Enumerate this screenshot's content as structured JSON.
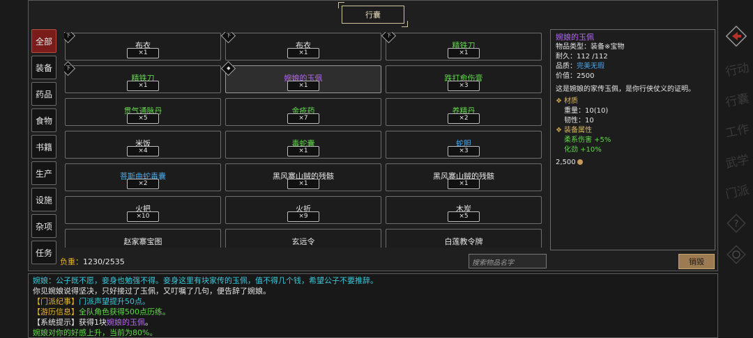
{
  "window": {
    "title": "行囊"
  },
  "categories": [
    "全部",
    "装备",
    "药品",
    "食物",
    "书籍",
    "生产",
    "设施",
    "杂项",
    "任务"
  ],
  "items": [
    {
      "name": "布衣",
      "qty": "×1",
      "color": "white",
      "tag": "下"
    },
    {
      "name": "布衣",
      "qty": "×1",
      "color": "white",
      "tag": "下"
    },
    {
      "name": "精铁刀",
      "qty": "×1",
      "color": "green",
      "tag": "下"
    },
    {
      "name": "精铁刀",
      "qty": "×1",
      "color": "green",
      "tag": "下"
    },
    {
      "name": "婉娘的玉佩",
      "qty": "×1",
      "color": "purple",
      "tag": "◆",
      "selected": true
    },
    {
      "name": "跌打愈伤膏",
      "qty": "×3",
      "color": "green"
    },
    {
      "name": "贯气通脉丹",
      "qty": "×5",
      "color": "green"
    },
    {
      "name": "金疮药",
      "qty": "×7",
      "color": "green"
    },
    {
      "name": "养精丹",
      "qty": "×2",
      "color": "green"
    },
    {
      "name": "米饭",
      "qty": "×4",
      "color": "white"
    },
    {
      "name": "毒蛇囊",
      "qty": "×1",
      "color": "green"
    },
    {
      "name": "蛇胆",
      "qty": "×3",
      "color": "blue"
    },
    {
      "name": "菩斯曲蛇毒囊",
      "qty": "×2",
      "color": "blue"
    },
    {
      "name": "黑风寨山贼的残骸",
      "qty": "×1",
      "color": "white"
    },
    {
      "name": "黑风寨山贼的残骸",
      "qty": "×1",
      "color": "white"
    },
    {
      "name": "火把",
      "qty": "×10",
      "color": "white"
    },
    {
      "name": "火折",
      "qty": "×9",
      "color": "white"
    },
    {
      "name": "木炭",
      "qty": "×5",
      "color": "white"
    },
    {
      "name": "赵家寨宝图",
      "qty": "",
      "color": "white"
    },
    {
      "name": "玄远令",
      "qty": "",
      "color": "white"
    },
    {
      "name": "白莲教令牌",
      "qty": "",
      "color": "white"
    }
  ],
  "detail": {
    "name": "婉娘的玉佩",
    "type_label": "物品类型：",
    "type_value": "装备※宝物",
    "durability_label": "耐久：",
    "durability_value": "112 /112",
    "quality_label": "品质：",
    "quality_value": "完美无瑕",
    "price_label": "价值：",
    "price_value": "2500",
    "description": "这是婉娘的家传玉佩，是你行侠仗义的证明。",
    "material_header": "材质",
    "weight_text": "重量：10(10)",
    "toughness_text": "韧性：10",
    "attr_header": "装备属性",
    "attr1": "柔系伤害 +5%",
    "attr2": "化劲 +10%",
    "coin": "2,500"
  },
  "footer": {
    "load_label": "负重：",
    "load_value": "1230/2535",
    "search_placeholder": "搜索物品名字",
    "destroy_label": "销毁"
  },
  "log": [
    [
      {
        "t": "婉娘：公子既不愿，妾身也勉强不得。妾身这里有块家传的玉佩，值不得几个钱，希望公子不要推辞。",
        "c": "cyan"
      }
    ],
    [
      {
        "t": "你见婉娘说得坚决，只好接过了玉佩，又叮嘱了几句，便告辞了婉娘。",
        "c": "white"
      }
    ],
    [
      {
        "t": "【门派纪事】",
        "c": "gold"
      },
      {
        "t": "门派声望提升50点。",
        "c": "cyan"
      }
    ],
    [
      {
        "t": "【游历信息】",
        "c": "gold"
      },
      {
        "t": "全队角色获得500点历练。",
        "c": "green"
      }
    ],
    [
      {
        "t": "【系统提示】获得1块",
        "c": "white"
      },
      {
        "t": "婉娘的玉佩",
        "c": "purple"
      },
      {
        "t": "。",
        "c": "white"
      }
    ],
    [
      {
        "t": "婉娘对你的好感上升，当前为80%。",
        "c": "green"
      }
    ]
  ],
  "side_menu": [
    "行动",
    "行囊",
    "工作",
    "武学",
    "门派"
  ]
}
